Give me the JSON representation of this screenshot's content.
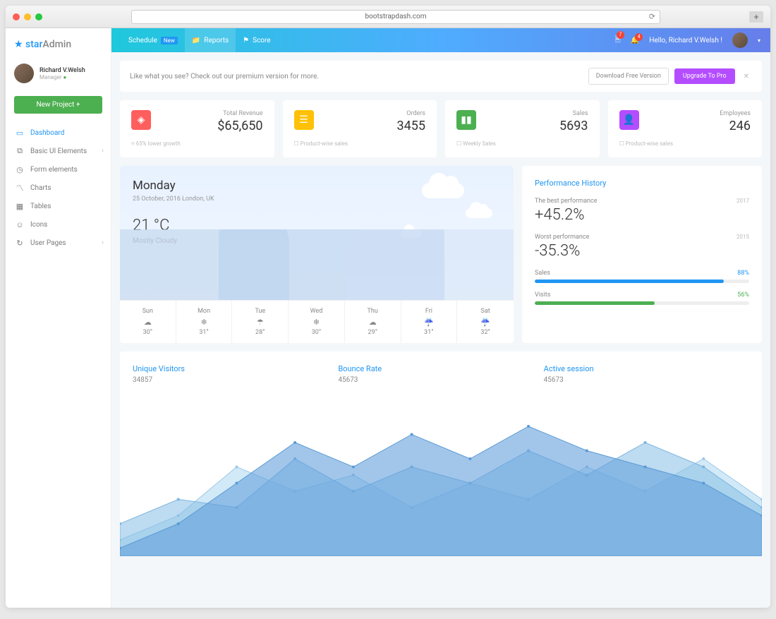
{
  "browser": {
    "url": "bootstrapdash.com"
  },
  "logo": {
    "part1": "star",
    "part2": "Admin"
  },
  "user": {
    "name": "Richard V.Welsh",
    "role": "Manager"
  },
  "newProjectBtn": "New Project  +",
  "nav": [
    {
      "label": "Dashboard",
      "active": true,
      "chev": false
    },
    {
      "label": "Basic UI Elements",
      "active": false,
      "chev": true
    },
    {
      "label": "Form elements",
      "active": false,
      "chev": false
    },
    {
      "label": "Charts",
      "active": false,
      "chev": false
    },
    {
      "label": "Tables",
      "active": false,
      "chev": false
    },
    {
      "label": "Icons",
      "active": false,
      "chev": false
    },
    {
      "label": "User Pages",
      "active": false,
      "chev": true
    }
  ],
  "topbar": {
    "schedule": "Schedule",
    "new": "New",
    "reports": "Reports",
    "score": "Score",
    "greeting": "Hello, Richard V.Welsh !",
    "badge1": "7",
    "badge2": "4"
  },
  "promo": {
    "text": "Like what you see? Check out our premium version for more.",
    "download": "Download Free Version",
    "upgrade": "Upgrade To Pro"
  },
  "stats": [
    {
      "label": "Total Revenue",
      "value": "$65,650",
      "foot": "65% lower growth",
      "icon": "cube"
    },
    {
      "label": "Orders",
      "value": "3455",
      "foot": "Product-wise sales",
      "icon": "list"
    },
    {
      "label": "Sales",
      "value": "5693",
      "foot": "Weekly Sales",
      "icon": "chart"
    },
    {
      "label": "Employees",
      "value": "246",
      "foot": "Product-wise sales",
      "icon": "user"
    }
  ],
  "weather": {
    "day": "Monday",
    "date": "25 October, 2016 London, UK",
    "temp": "21 °C",
    "desc": "Mostly Cloudy",
    "forecast": [
      {
        "d": "Sun",
        "t": "30°"
      },
      {
        "d": "Mon",
        "t": "31°"
      },
      {
        "d": "Tue",
        "t": "28°"
      },
      {
        "d": "Wed",
        "t": "30°"
      },
      {
        "d": "Thu",
        "t": "29°"
      },
      {
        "d": "Fri",
        "t": "31°"
      },
      {
        "d": "Sat",
        "t": "32°"
      }
    ]
  },
  "perf": {
    "title": "Performance History",
    "best": {
      "label": "The best performance",
      "year": "2017",
      "value": "+45.2%"
    },
    "worst": {
      "label": "Worst performance",
      "year": "2015",
      "value": "-35.3%"
    },
    "bars": [
      {
        "label": "Sales",
        "pct": "88%",
        "w": 88,
        "cls": "bf-blue",
        "pcls": ""
      },
      {
        "label": "Visits",
        "pct": "56%",
        "w": 56,
        "cls": "bf-green",
        "pcls": "g"
      }
    ]
  },
  "chart": {
    "h": [
      {
        "title": "Unique Visitors",
        "val": "34857"
      },
      {
        "title": "Bounce Rate",
        "val": "45673"
      },
      {
        "title": "Active session",
        "val": "45673"
      }
    ]
  },
  "chart_data": {
    "type": "area",
    "x": [
      0,
      1,
      2,
      3,
      4,
      5,
      6,
      7,
      8,
      9,
      10,
      11
    ],
    "series": [
      {
        "name": "Unique Visitors",
        "values": [
          10,
          25,
          55,
          40,
          50,
          30,
          45,
          35,
          55,
          40,
          60,
          35
        ]
      },
      {
        "name": "Bounce Rate",
        "values": [
          20,
          35,
          30,
          60,
          40,
          55,
          45,
          65,
          50,
          70,
          55,
          30
        ]
      },
      {
        "name": "Active session",
        "values": [
          5,
          20,
          45,
          70,
          55,
          75,
          60,
          80,
          65,
          55,
          45,
          25
        ]
      }
    ],
    "ylim": [
      0,
      100
    ]
  }
}
